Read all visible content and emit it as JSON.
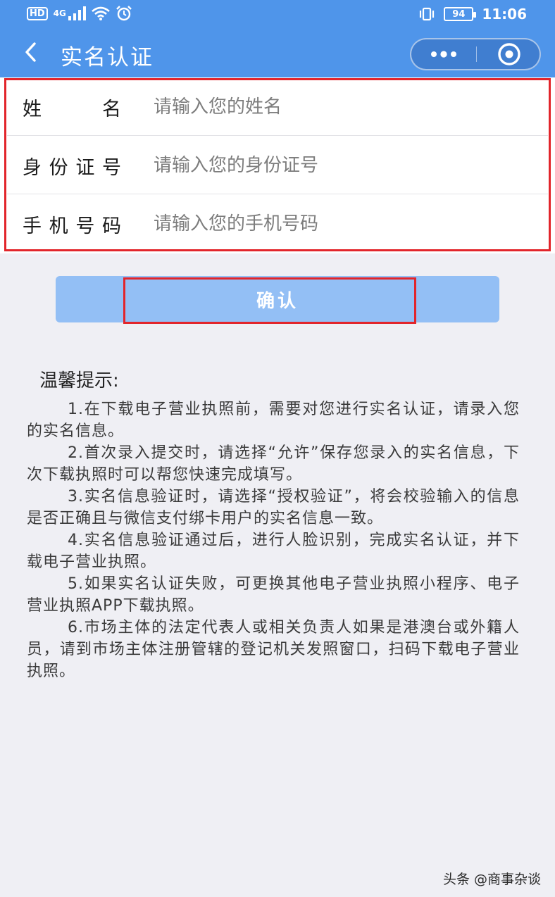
{
  "status_bar": {
    "network_badge": "HD",
    "signal_label": "4G",
    "battery_level": "94",
    "time": "11:06"
  },
  "nav": {
    "title": "实名认证"
  },
  "form": {
    "fields": [
      {
        "label": "姓名",
        "placeholder": "请输入您的姓名"
      },
      {
        "label": "身份证号",
        "placeholder": "请输入您的身份证号"
      },
      {
        "label": "手机号码",
        "placeholder": "请输入您的手机号码"
      }
    ]
  },
  "confirm_label": "确认",
  "tips": {
    "title": "温馨提示:",
    "items": [
      "1.在下载电子营业执照前，需要对您进行实名认证，请录入您的实名信息。",
      "2.首次录入提交时，请选择“允许”保存您录入的实名信息，下次下载执照时可以帮您快速完成填写。",
      "3.实名信息验证时，请选择“授权验证”，将会校验输入的信息是否正确且与微信支付绑卡用户的实名信息一致。",
      "4.实名信息验证通过后，进行人脸识别，完成实名认证，并下载电子营业执照。",
      "5.如果实名认证失败，可更换其他电子营业执照小程序、电子营业执照APP下载执照。",
      "6.市场主体的法定代表人或相关负责人如果是港澳台或外籍人员，请到市场主体注册管辖的登记机关发照窗口，扫码下载电子营业执照。"
    ]
  },
  "watermark": "头条 @商事杂谈",
  "colors": {
    "header_bg": "#4f95ea",
    "page_bg": "#efeff4",
    "button_bg": "#93bff5",
    "highlight": "#e2252b"
  },
  "icons": {
    "back": "chevron-left-icon",
    "more": "more-dots-icon",
    "close": "target-close-icon",
    "wifi": "wifi-icon",
    "alarm": "alarm-icon",
    "vibrate": "vibrate-icon"
  }
}
